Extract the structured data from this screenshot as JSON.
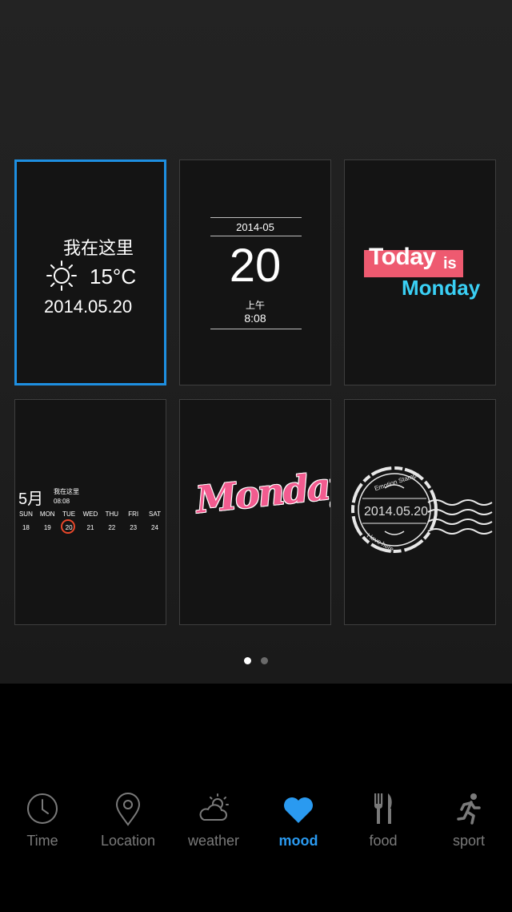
{
  "cards": {
    "location": {
      "place": "我在这里",
      "temperature": "15°C",
      "date": "2014.05.20"
    },
    "date_time": {
      "year_month": "2014-05",
      "day": "20",
      "am_pm": "上午",
      "time": "8:08"
    },
    "today_is": {
      "today": "Today",
      "is": "is",
      "weekday": "Monday"
    },
    "calendar": {
      "month": "5月",
      "place": "我在这里",
      "time": "08:08",
      "weekdays": [
        "SUN",
        "MON",
        "TUE",
        "WED",
        "THU",
        "FRI",
        "SAT"
      ],
      "dates": [
        "18",
        "19",
        "20",
        "21",
        "22",
        "23",
        "24"
      ]
    },
    "monday_script": {
      "text": "Monday"
    },
    "stamp": {
      "date": "2014.05.20",
      "top_text": "Emotion Stamps",
      "bottom_text": "I love here"
    }
  },
  "pager": {
    "pages": 2,
    "current": 1
  },
  "nav": {
    "items": [
      {
        "label": "Time",
        "icon": "clock-icon"
      },
      {
        "label": "Location",
        "icon": "map-pin-icon"
      },
      {
        "label": "weather",
        "icon": "partly-cloudy-icon"
      },
      {
        "label": "mood",
        "icon": "heart-icon"
      },
      {
        "label": "food",
        "icon": "fork-knife-icon"
      },
      {
        "label": "sport",
        "icon": "runner-icon"
      }
    ],
    "active": "mood"
  },
  "colors": {
    "accent": "#1e8fe1",
    "active_nav": "#2a9af0",
    "inactive_nav": "#7a7a7a",
    "pink": "#ee5a70",
    "cyan": "#3ad0f5"
  }
}
